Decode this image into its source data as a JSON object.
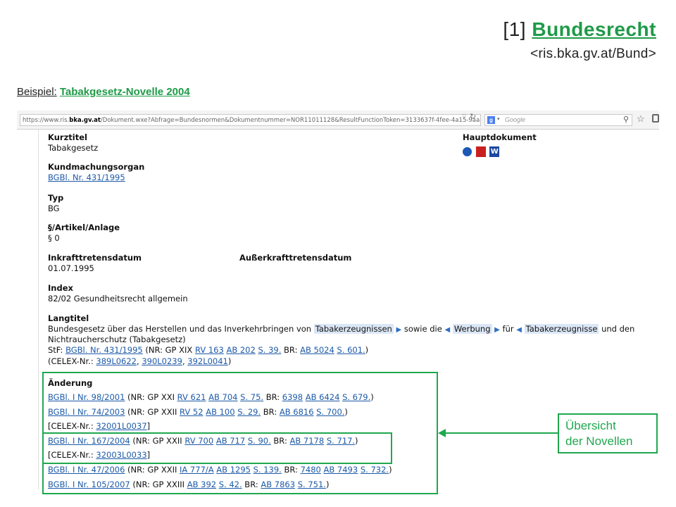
{
  "header": {
    "prefix": "[1]",
    "title": "Bundesrecht",
    "subtitle": "<ris.bka.gv.at/Bund>"
  },
  "example": {
    "label": "Beispiel:",
    "link": "Tabakgesetz-Novelle 2004"
  },
  "browser": {
    "url_pre": "https://www.ris.",
    "url_bold": "bka.gv.at",
    "url_post": "/Dokument.wxe?Abfrage=Bundesnormen&Dokumentnummer=NOR11011128&ResultFunctionToken=3133637f-4fee-4a15-9aaa",
    "search_placeholder": "Google"
  },
  "document": {
    "kurztitel_label": "Kurztitel",
    "kurztitel_value": "Tabakgesetz",
    "hauptdokument_label": "Hauptdokument",
    "kundmachungsorgan_label": "Kundmachungsorgan",
    "kundmachungsorgan_link": "BGBl. Nr. 431/1995",
    "typ_label": "Typ",
    "typ_value": "BG",
    "artikel_label": "§/Artikel/Anlage",
    "artikel_value": "§ 0",
    "inkraft_label": "Inkrafttretensdatum",
    "inkraft_value": "01.07.1995",
    "ausserkraft_label": "Außerkrafttretensdatum",
    "index_label": "Index",
    "index_value": "82/02 Gesundheitsrecht allgemein",
    "langtitel_label": "Langtitel",
    "langtitel": {
      "t1": "Bundesgesetz über das Herstellen und das Inverkehrbringen von ",
      "tag1": "Tabakerzeugnissen",
      "t2": " sowie die ",
      "tag2": "Werbung",
      "t3": " für ",
      "tag3": "Tabakerzeugnisse",
      "t4": " und den",
      "line2": "Nichtraucherschutz (Tabakgesetz)"
    },
    "stf": {
      "pre": "StF: ",
      "link1": "BGBl. Nr. 431/1995",
      "mid1": " (NR: GP XIX ",
      "rv": "RV 163",
      "ab": "AB 202",
      "s": "S. 39.",
      "mid2": " BR: ",
      "br1": "AB 5024",
      "br2": "S. 601.",
      "end": ")"
    },
    "celex": {
      "pre": "(CELEX-Nr.: ",
      "c1": "389L0622",
      "c2": "390L0239",
      "c3": "392L0041",
      "end": ")"
    },
    "aenderung_label": "Änderung",
    "aenderungen": [
      {
        "link": "BGBl. I Nr. 98/2001",
        "gp": " (NR: GP XXI ",
        "a": "RV 621",
        "b": "AB 704",
        "c": "S. 75.",
        "br": " BR: ",
        "d": "6398",
        "e": "AB 6424",
        "f": "S. 679.",
        "end": ")"
      },
      {
        "link": "BGBl. I Nr. 74/2003",
        "gp": " (NR: GP XXII ",
        "a": "RV 52",
        "b": "AB 100",
        "c": "S. 29.",
        "br": " BR: ",
        "d": "AB 6816",
        "e": "S. 700.",
        "f": "",
        "end": ")"
      },
      {
        "celex_pre": "[CELEX-Nr.: ",
        "celex": "32001L0037",
        "celex_end": "]"
      },
      {
        "link": "BGBl. I Nr. 167/2004",
        "gp": " (NR: GP XXII ",
        "a": "RV 700",
        "b": "AB 717",
        "c": "S. 90.",
        "br": " BR: ",
        "d": "AB 7178",
        "e": "S. 717.",
        "f": "",
        "end": ")"
      },
      {
        "celex_pre": "[CELEX-Nr.: ",
        "celex": "32003L0033",
        "celex_end": "]"
      },
      {
        "link": "BGBl. I Nr. 47/2006",
        "gp": " (NR: GP XXII ",
        "a": "IA 777/A",
        "b": "AB 1295",
        "c": "S. 139.",
        "br": " BR: ",
        "d": "7480",
        "e": "AB 7493",
        "f": "S. 732.",
        "end": ")"
      },
      {
        "link": "BGBl. I Nr. 105/2007",
        "gp": " (NR: GP XXIII ",
        "a": "AB 392",
        "b": "S. 42.",
        "c": "",
        "br": " BR: ",
        "d": "AB 7863",
        "e": "S. 751.",
        "f": "",
        "end": ")"
      }
    ]
  },
  "annotation": {
    "line1": "Übersicht",
    "line2": "der Novellen"
  },
  "colors": {
    "accent": "#1fa84f",
    "link": "#1d5aa8",
    "highlight": "#dbe7f6"
  }
}
